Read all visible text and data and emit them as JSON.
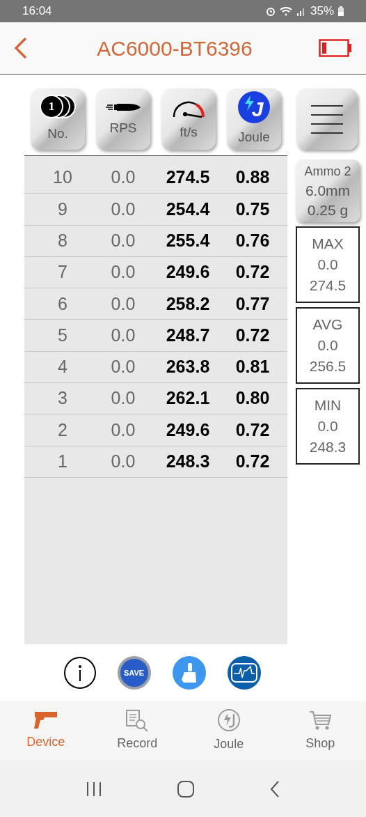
{
  "status_bar": {
    "time": "16:04",
    "battery": "35%"
  },
  "header": {
    "title": "AC6000-BT6396"
  },
  "toolbar": [
    {
      "kind": "coins",
      "label": "No.",
      "glyph": "1"
    },
    {
      "kind": "bullet",
      "label": "RPS"
    },
    {
      "kind": "gauge",
      "label": "ft/s"
    },
    {
      "kind": "joule",
      "label": "Joule",
      "glyph": "J"
    },
    {
      "kind": "menu"
    }
  ],
  "table": {
    "rows": [
      {
        "no": "10",
        "rps": "0.0",
        "fps": "274.5",
        "joule": "0.88"
      },
      {
        "no": "9",
        "rps": "0.0",
        "fps": "254.4",
        "joule": "0.75"
      },
      {
        "no": "8",
        "rps": "0.0",
        "fps": "255.4",
        "joule": "0.76"
      },
      {
        "no": "7",
        "rps": "0.0",
        "fps": "249.6",
        "joule": "0.72"
      },
      {
        "no": "6",
        "rps": "0.0",
        "fps": "258.2",
        "joule": "0.77"
      },
      {
        "no": "5",
        "rps": "0.0",
        "fps": "248.7",
        "joule": "0.72"
      },
      {
        "no": "4",
        "rps": "0.0",
        "fps": "263.8",
        "joule": "0.81"
      },
      {
        "no": "3",
        "rps": "0.0",
        "fps": "262.1",
        "joule": "0.80"
      },
      {
        "no": "2",
        "rps": "0.0",
        "fps": "249.6",
        "joule": "0.72"
      },
      {
        "no": "1",
        "rps": "0.0",
        "fps": "248.3",
        "joule": "0.72"
      }
    ]
  },
  "ammo": {
    "name": "Ammo 2",
    "caliber": "6.0mm",
    "weight": "0.25 g"
  },
  "stats": [
    {
      "label": "MAX",
      "rps": "0.0",
      "fps": "274.5"
    },
    {
      "label": "AVG",
      "rps": "0.0",
      "fps": "256.5"
    },
    {
      "label": "MIN",
      "rps": "0.0",
      "fps": "248.3"
    }
  ],
  "actions": [
    {
      "kind": "info"
    },
    {
      "kind": "save",
      "label": "SAVE"
    },
    {
      "kind": "clear"
    },
    {
      "kind": "chart"
    }
  ],
  "bottom_nav": [
    {
      "kind": "device",
      "label": "Device",
      "selected": true
    },
    {
      "kind": "record",
      "label": "Record",
      "selected": false
    },
    {
      "kind": "joule",
      "label": "Joule",
      "selected": false
    },
    {
      "kind": "shop",
      "label": "Shop",
      "selected": false
    }
  ]
}
